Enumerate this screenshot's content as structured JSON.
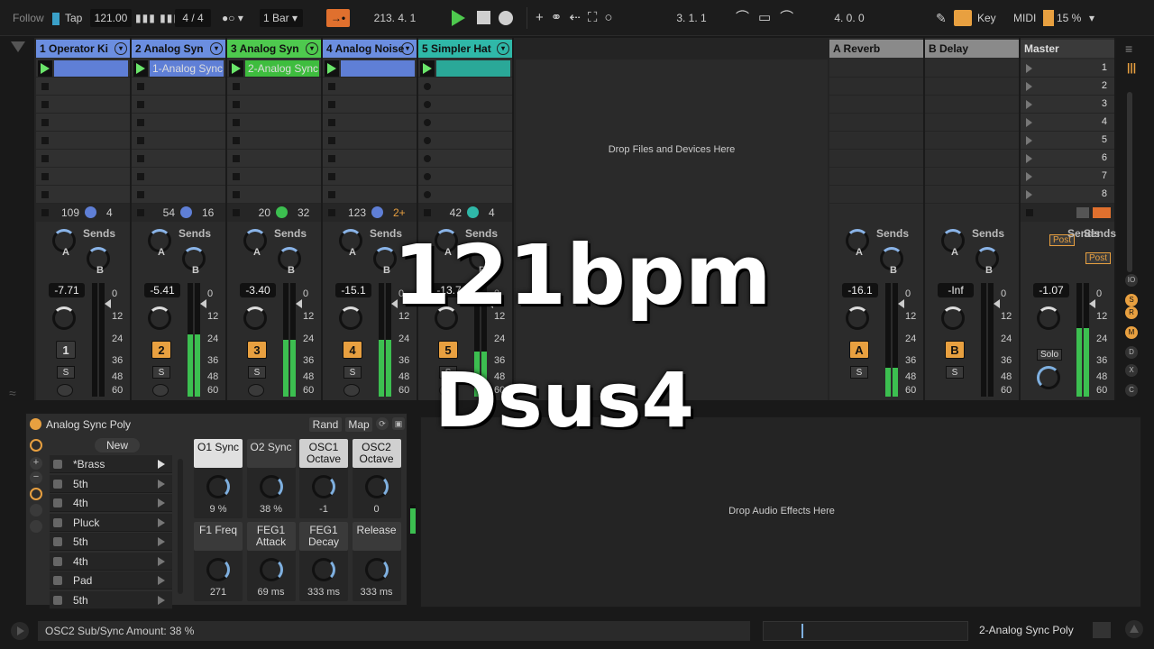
{
  "transport": {
    "follow_label": "Follow",
    "tap_label": "Tap",
    "tempo": "121.00",
    "time_signature": "4 / 4",
    "quantize": "1 Bar",
    "position": "213.   4.   1",
    "loop_start": "3.   1.   1",
    "loop_length": "4.   0.   0",
    "key_label": "Key",
    "midi_label": "MIDI",
    "cpu": "15 %"
  },
  "tracks": [
    {
      "name": "1 Operator Ki",
      "color": "#6b8ee0",
      "clip": "",
      "clip_color": "#5f7fd6",
      "voices": "109",
      "sends_count": "4",
      "volume": "-7.71",
      "number": "1",
      "meter": 0.0
    },
    {
      "name": "2 Analog Syn",
      "color": "#6b8ee0",
      "clip": "1-Analog Sync",
      "clip_color": "#5f7fd6",
      "voices": "54",
      "sends_count": "16",
      "volume": "-5.41",
      "number": "2",
      "meter": 0.55
    },
    {
      "name": "3 Analog Syn",
      "color": "#4ec94e",
      "clip": "2-Analog Sync",
      "clip_color": "#3ebd3e",
      "voices": "20",
      "sends_count": "32",
      "volume": "-3.40",
      "number": "3",
      "meter": 0.5
    },
    {
      "name": "4 Analog Noise",
      "color": "#6b8ee0",
      "clip": "",
      "clip_color": "#5f7fd6",
      "voices": "123",
      "sends_count": "2+",
      "volume": "-15.1",
      "number": "4",
      "meter": 0.5
    },
    {
      "name": "5 Simpler Hat",
      "color": "#2fb8a8",
      "clip": "",
      "clip_color": "#2aa898",
      "voices": "42",
      "sends_count": "4",
      "volume": "-13.7",
      "number": "5",
      "meter": 0.4
    }
  ],
  "returns": [
    {
      "name": "A Reverb",
      "volume": "-16.1",
      "letter": "A"
    },
    {
      "name": "B Delay",
      "volume": "-Inf",
      "letter": "B"
    }
  ],
  "master": {
    "name": "Master",
    "volume": "-1.07",
    "solo_label": "Solo",
    "post1": "Post",
    "post2": "Post",
    "scenes": [
      "1",
      "2",
      "3",
      "4",
      "5",
      "6",
      "7",
      "8"
    ]
  },
  "session": {
    "drop_files": "Drop Files and Devices Here",
    "sends_label": "Sends",
    "send_a": "A",
    "send_b": "B",
    "solo_s": "S"
  },
  "db_scale": [
    "0",
    "12",
    "24",
    "36",
    "48",
    "60"
  ],
  "device": {
    "title": "Analog Sync Poly",
    "rand_label": "Rand",
    "map_label": "Map",
    "new_label": "New",
    "presets": [
      "*Brass",
      "5th",
      "4th",
      "Pluck",
      "5th",
      "4th",
      "Pad",
      "5th"
    ],
    "macros": [
      {
        "label": "O1 Sync",
        "value": "9 %",
        "active": true
      },
      {
        "label": "O2 Sync",
        "value": "38 %",
        "active": false
      },
      {
        "label": "OSC1 Octave",
        "value": "-1",
        "active": true
      },
      {
        "label": "OSC2 Octave",
        "value": "0",
        "active": true
      },
      {
        "label": "F1 Freq",
        "value": "271",
        "active": false
      },
      {
        "label": "FEG1 Attack",
        "value": "69 ms",
        "active": false
      },
      {
        "label": "FEG1 Decay",
        "value": "333 ms",
        "active": false
      },
      {
        "label": "Release",
        "value": "333 ms",
        "active": false
      }
    ]
  },
  "effects": {
    "drop_audio": "Drop Audio Effects Here"
  },
  "status": {
    "message": "OSC2 Sub/Sync Amount: 38 %",
    "clip_name": "2-Analog Sync Poly"
  },
  "overlay": {
    "bpm": "121bpm",
    "chord": "Dsus4"
  }
}
